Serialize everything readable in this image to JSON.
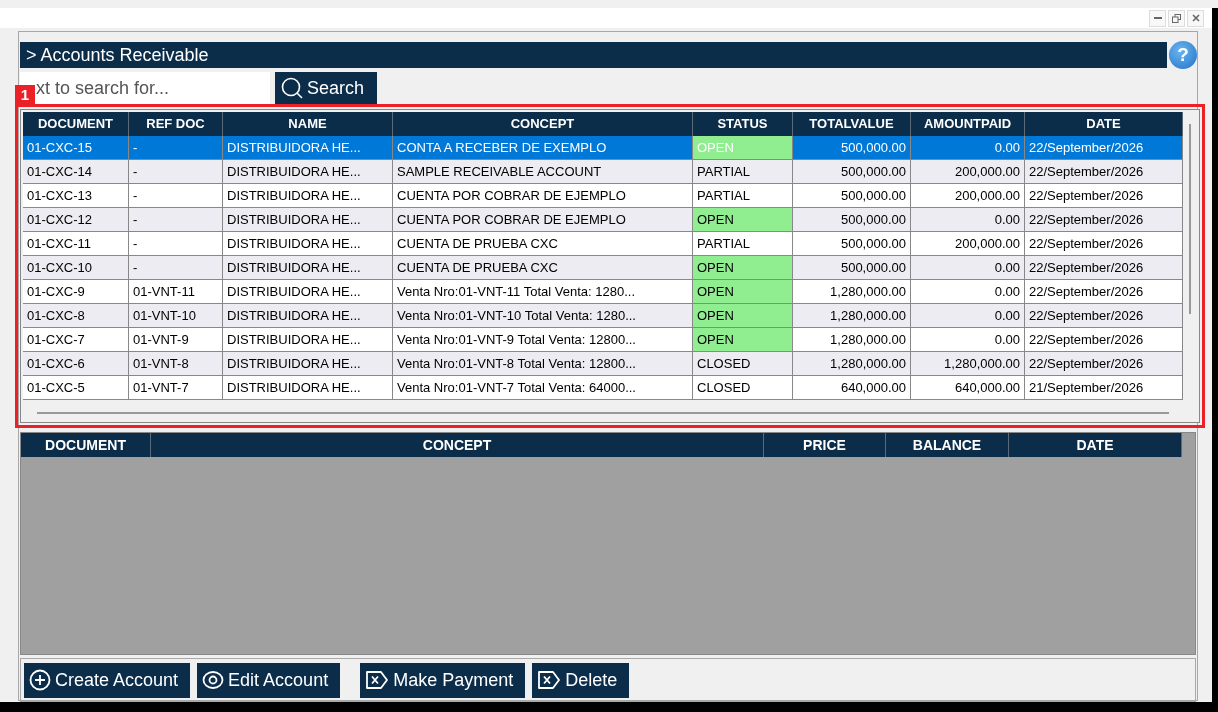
{
  "title_bar": {
    "controls": [
      {
        "kind": "minimize"
      },
      {
        "kind": "restore"
      },
      {
        "kind": "close"
      }
    ]
  },
  "header": {
    "title": "> Accounts Receivable",
    "help": "?"
  },
  "search": {
    "placeholder": "xt to search for...",
    "button": "Search"
  },
  "callout": {
    "label": "1"
  },
  "accounts_table": {
    "columns": [
      "DOCUMENT",
      "REF DOC",
      "NAME",
      "CONCEPT",
      "STATUS",
      "TOTALVALUE",
      "AMOUNTPAID",
      "DATE"
    ],
    "rows": [
      {
        "cells": [
          "01-CXC-15",
          "-",
          "DISTRIBUIDORA HE...",
          "CONTA A RECEBER DE EXEMPLO",
          "OPEN",
          "500,000.00",
          "0.00",
          "22/September/2026"
        ],
        "selected": true,
        "status_highlight": true
      },
      {
        "cells": [
          "01-CXC-14",
          "-",
          "DISTRIBUIDORA HE...",
          "SAMPLE RECEIVABLE ACCOUNT",
          "PARTIAL",
          "500,000.00",
          "200,000.00",
          "22/September/2026"
        ],
        "selected": false,
        "status_highlight": false
      },
      {
        "cells": [
          "01-CXC-13",
          "-",
          "DISTRIBUIDORA HE...",
          "CUENTA POR COBRAR DE EJEMPLO",
          "PARTIAL",
          "500,000.00",
          "200,000.00",
          "22/September/2026"
        ],
        "selected": false,
        "status_highlight": false
      },
      {
        "cells": [
          "01-CXC-12",
          "-",
          "DISTRIBUIDORA HE...",
          "CUENTA POR COBRAR DE EJEMPLO",
          "OPEN",
          "500,000.00",
          "0.00",
          "22/September/2026"
        ],
        "selected": false,
        "status_highlight": true
      },
      {
        "cells": [
          "01-CXC-11",
          "-",
          "DISTRIBUIDORA HE...",
          "CUENTA DE PRUEBA CXC",
          "PARTIAL",
          "500,000.00",
          "200,000.00",
          "22/September/2026"
        ],
        "selected": false,
        "status_highlight": false
      },
      {
        "cells": [
          "01-CXC-10",
          "-",
          "DISTRIBUIDORA HE...",
          "CUENTA DE PRUEBA CXC",
          "OPEN",
          "500,000.00",
          "0.00",
          "22/September/2026"
        ],
        "selected": false,
        "status_highlight": true
      },
      {
        "cells": [
          "01-CXC-9",
          "01-VNT-11",
          "DISTRIBUIDORA HE...",
          "Venta Nro:01-VNT-11 Total Venta: 1280...",
          "OPEN",
          "1,280,000.00",
          "0.00",
          "22/September/2026"
        ],
        "selected": false,
        "status_highlight": true
      },
      {
        "cells": [
          "01-CXC-8",
          "01-VNT-10",
          "DISTRIBUIDORA HE...",
          "Venta Nro:01-VNT-10 Total Venta: 1280...",
          "OPEN",
          "1,280,000.00",
          "0.00",
          "22/September/2026"
        ],
        "selected": false,
        "status_highlight": true
      },
      {
        "cells": [
          "01-CXC-7",
          "01-VNT-9",
          "DISTRIBUIDORA HE...",
          "Venta Nro:01-VNT-9 Total Venta: 12800...",
          "OPEN",
          "1,280,000.00",
          "0.00",
          "22/September/2026"
        ],
        "selected": false,
        "status_highlight": true
      },
      {
        "cells": [
          "01-CXC-6",
          "01-VNT-8",
          "DISTRIBUIDORA HE...",
          "Venta Nro:01-VNT-8 Total Venta: 12800...",
          "CLOSED",
          "1,280,000.00",
          "1,280,000.00",
          "22/September/2026"
        ],
        "selected": false,
        "status_highlight": false
      },
      {
        "cells": [
          "01-CXC-5",
          "01-VNT-7",
          "DISTRIBUIDORA HE...",
          "Venta Nro:01-VNT-7 Total Venta: 64000...",
          "CLOSED",
          "640,000.00",
          "640,000.00",
          "21/September/2026"
        ],
        "selected": false,
        "status_highlight": false
      }
    ]
  },
  "detail_table": {
    "columns": [
      "DOCUMENT",
      "CONCEPT",
      "PRICE",
      "BALANCE",
      "DATE"
    ]
  },
  "actions": [
    {
      "label": "Create Account",
      "kind": "plus"
    },
    {
      "label": "Edit Account",
      "kind": "ring"
    },
    {
      "label": "Make Payment",
      "kind": "x-tag"
    },
    {
      "label": "Delete",
      "kind": "x-tag"
    }
  ]
}
